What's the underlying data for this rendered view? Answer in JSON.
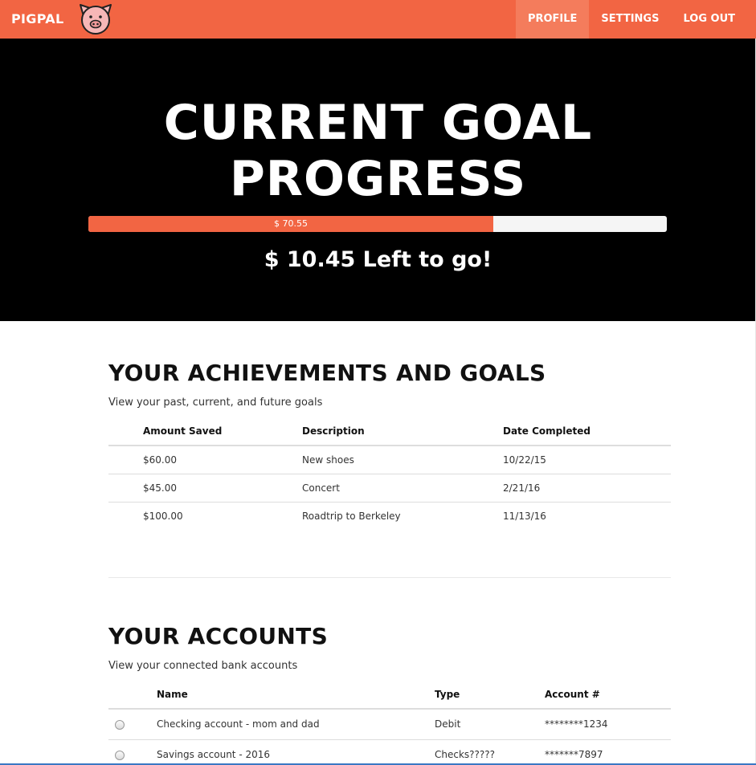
{
  "nav": {
    "brand": "PIGPAL",
    "items": [
      {
        "label": "PROFILE",
        "active": true
      },
      {
        "label": "SETTINGS",
        "active": false
      },
      {
        "label": "LOG OUT",
        "active": false
      }
    ]
  },
  "hero": {
    "title_line1": "CURRENT GOAL",
    "title_line2": "PROGRESS",
    "progress_label": "$ 70.55",
    "progress_fraction": 0.7,
    "left_to_go": "$ 10.45 Left to go!"
  },
  "goals": {
    "title": "YOUR ACHIEVEMENTS AND GOALS",
    "subtitle": "View your past, current, and future goals",
    "headers": [
      "Amount Saved",
      "Description",
      "Date Completed"
    ],
    "rows": [
      {
        "amount": "$60.00",
        "description": "New shoes",
        "date": "10/22/15"
      },
      {
        "amount": "$45.00",
        "description": "Concert",
        "date": "2/21/16"
      },
      {
        "amount": "$100.00",
        "description": "Roadtrip to Berkeley",
        "date": "11/13/16"
      }
    ]
  },
  "accounts": {
    "title": "YOUR ACCOUNTS",
    "subtitle": "View your connected bank accounts",
    "headers": [
      "Name",
      "Type",
      "Account #"
    ],
    "rows": [
      {
        "name": "Checking account - mom and dad",
        "type": "Debit",
        "number": "********1234"
      },
      {
        "name": "Savings account - 2016",
        "type": "Checks?????",
        "number": "*******7897"
      }
    ]
  },
  "colors": {
    "brand": "#f26543",
    "brand_active": "#f47c5c",
    "hero_bg": "#000000"
  }
}
